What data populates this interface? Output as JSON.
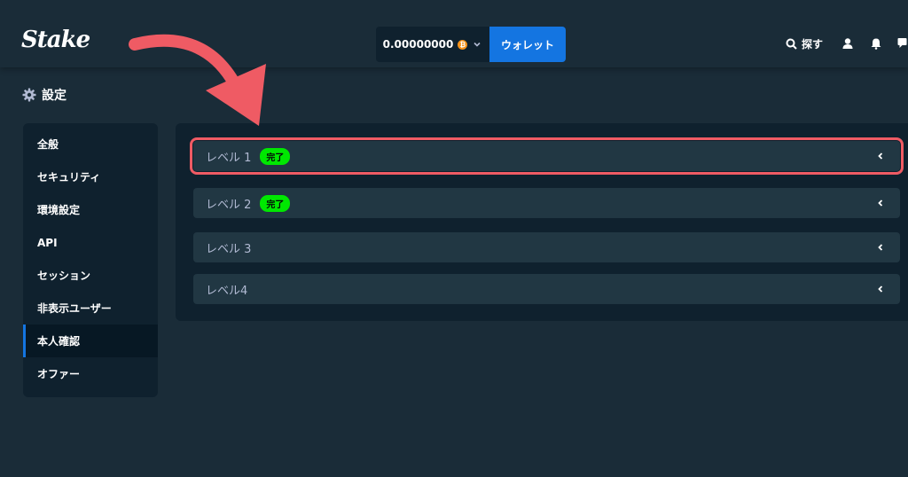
{
  "header": {
    "logo": "Stake",
    "balance": "0.00000000",
    "currency_icon": "bitcoin-icon",
    "wallet_label": "ウォレット",
    "search_label": "探す",
    "icons": [
      "search-icon",
      "user-icon",
      "bell-icon",
      "chat-icon"
    ]
  },
  "page": {
    "title": "設定",
    "title_icon": "gear-icon"
  },
  "sidebar": {
    "items": [
      {
        "label": "全般"
      },
      {
        "label": "セキュリティ"
      },
      {
        "label": "環境設定"
      },
      {
        "label": "API"
      },
      {
        "label": "セッション"
      },
      {
        "label": "非表示ユーザー"
      },
      {
        "label": "本人確認",
        "active": true
      },
      {
        "label": "オファー"
      }
    ]
  },
  "levels": [
    {
      "label": "レベル 1",
      "badge": "完了",
      "highlighted": true
    },
    {
      "label": "レベル 2",
      "badge": "完了"
    },
    {
      "label": "レベル 3"
    },
    {
      "label": "レベル4"
    }
  ],
  "colors": {
    "background": "#1a2c38",
    "panel": "#0f212e",
    "accent_blue": "#1475e1",
    "badge_green": "#00e701",
    "highlight_red": "#ef5b64"
  }
}
